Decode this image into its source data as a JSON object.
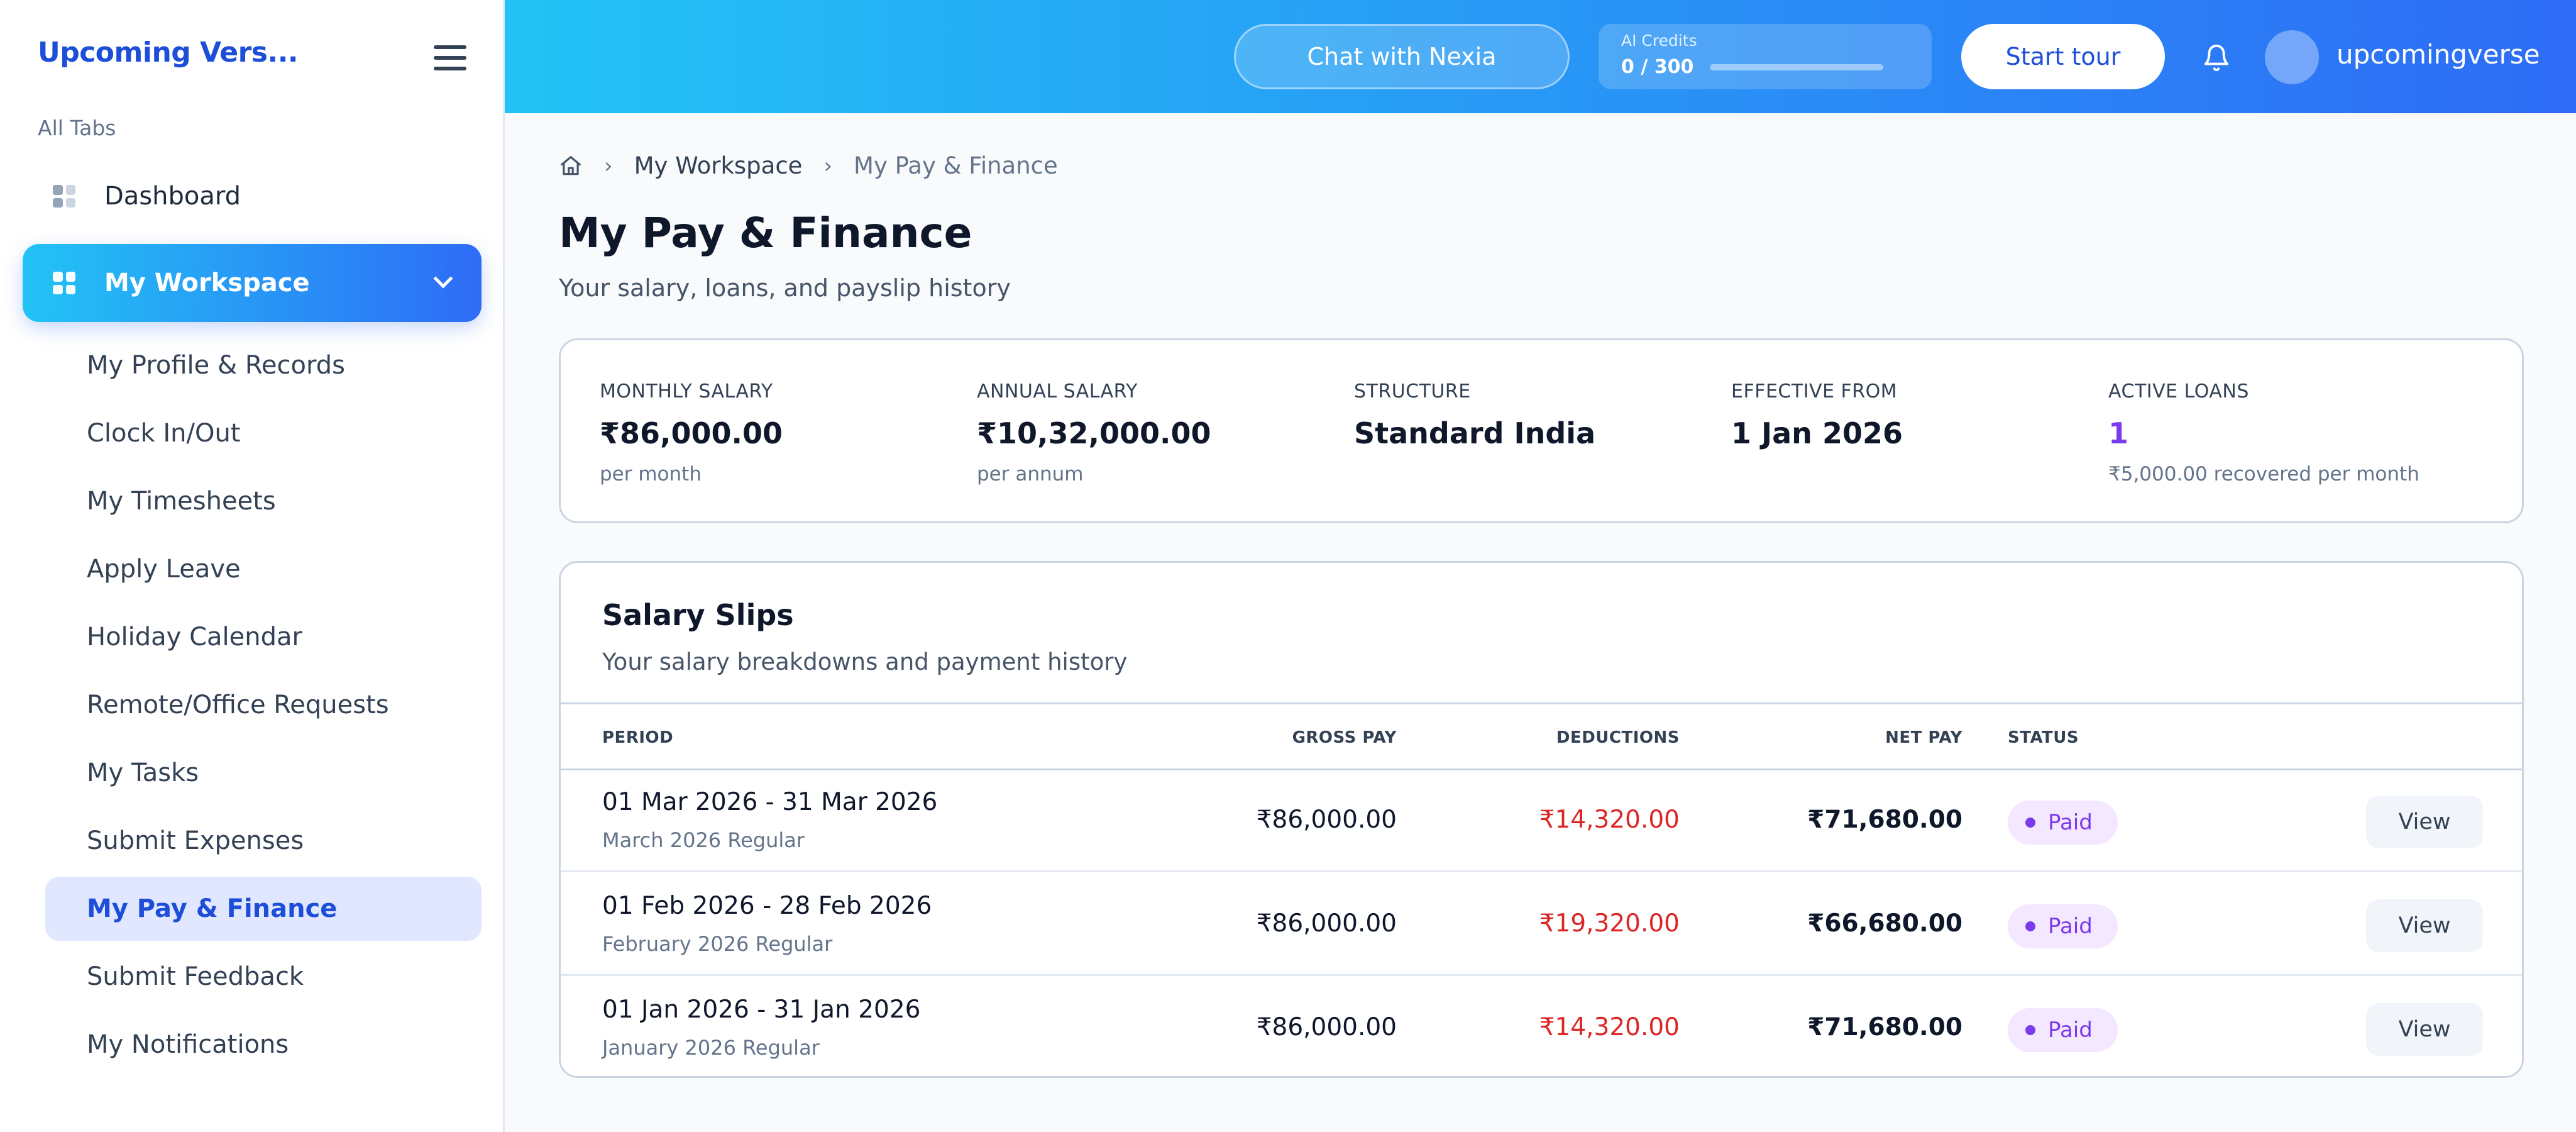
{
  "sidebar": {
    "brand": "Upcoming Vers...",
    "section_label": "All Tabs",
    "dashboard_label": "Dashboard",
    "workspace_label": "My Workspace",
    "items": [
      {
        "label": "My Profile & Records"
      },
      {
        "label": "Clock In/Out"
      },
      {
        "label": "My Timesheets"
      },
      {
        "label": "Apply Leave"
      },
      {
        "label": "Holiday Calendar"
      },
      {
        "label": "Remote/Office Requests"
      },
      {
        "label": "My Tasks"
      },
      {
        "label": "Submit Expenses"
      },
      {
        "label": "My Pay & Finance",
        "active": true
      },
      {
        "label": "Submit Feedback"
      },
      {
        "label": "My Notifications"
      }
    ]
  },
  "topbar": {
    "chat_label": "Chat with Nexia",
    "credits_label": "AI Credits",
    "credits_value": "0 / 300",
    "credits_fraction": 0,
    "tour_label": "Start tour",
    "username": "upcomingverse"
  },
  "breadcrumb": {
    "workspace": "My Workspace",
    "current": "My Pay & Finance"
  },
  "page": {
    "title": "My Pay & Finance",
    "subtitle": "Your salary, loans, and payslip history"
  },
  "summary": {
    "monthly_label": "MONTHLY SALARY",
    "monthly_value": "₹86,000.00",
    "monthly_sub": "per month",
    "annual_label": "ANNUAL SALARY",
    "annual_value": "₹10,32,000.00",
    "annual_sub": "per annum",
    "structure_label": "STRUCTURE",
    "structure_value": "Standard India",
    "effective_label": "EFFECTIVE FROM",
    "effective_value": "1 Jan 2026",
    "loans_label": "ACTIVE LOANS",
    "loans_value": "1",
    "loans_sub": "₹5,000.00 recovered per month"
  },
  "slips": {
    "title": "Salary Slips",
    "description": "Your salary breakdowns and payment history",
    "columns": {
      "period": "PERIOD",
      "gross": "GROSS PAY",
      "deductions": "DEDUCTIONS",
      "net": "NET PAY",
      "status": "STATUS"
    },
    "rows": [
      {
        "period": "01 Mar 2026 - 31 Mar 2026",
        "label": "March 2026 Regular",
        "gross": "₹86,000.00",
        "deductions": "₹14,320.00",
        "net": "₹71,680.00",
        "status": "Paid",
        "action": "View"
      },
      {
        "period": "01 Feb 2026 - 28 Feb 2026",
        "label": "February 2026 Regular",
        "gross": "₹86,000.00",
        "deductions": "₹19,320.00",
        "net": "₹66,680.00",
        "status": "Paid",
        "action": "View"
      },
      {
        "period": "01 Jan 2026 - 31 Jan 2026",
        "label": "January 2026 Regular",
        "gross": "₹86,000.00",
        "deductions": "₹14,320.00",
        "net": "₹71,680.00",
        "status": "Paid",
        "action": "View"
      }
    ]
  },
  "colors": {
    "accent": "#2e6cf6",
    "gradient_start": "#22c3f5",
    "deduction": "#dc2626",
    "paid_badge": "#7c3aed"
  },
  "icons": [
    "menu-icon",
    "grid-icon",
    "chevron-down-icon",
    "home-icon",
    "chevron-right-icon",
    "bell-icon",
    "avatar"
  ]
}
